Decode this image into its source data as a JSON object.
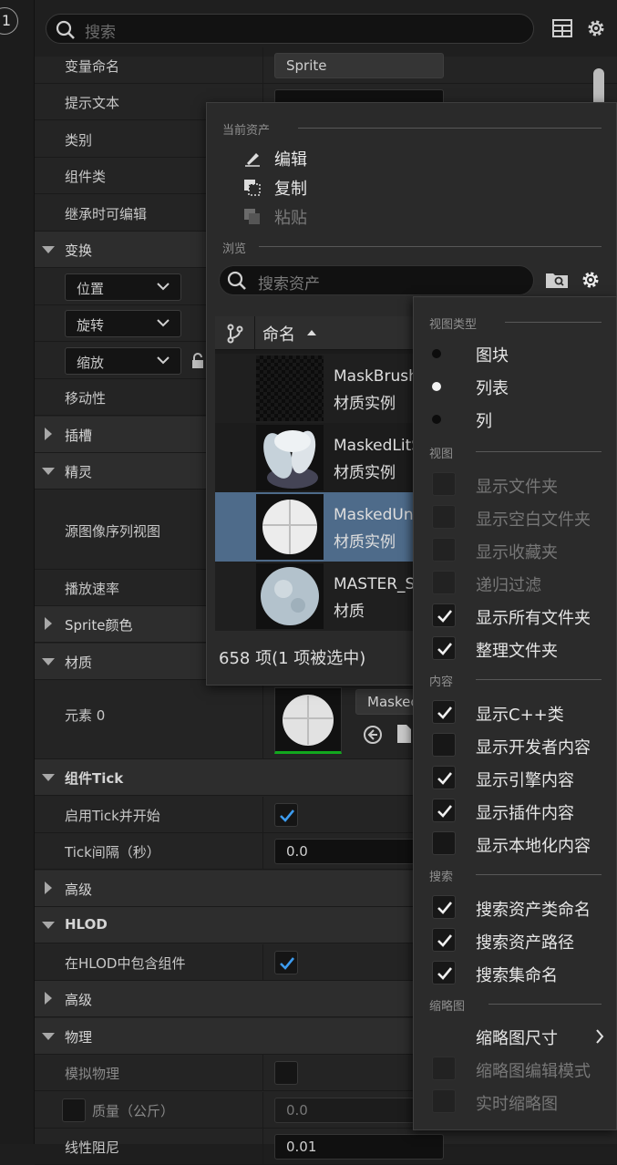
{
  "gutter_badge": "1",
  "details": {
    "search_placeholder": "搜索",
    "rows": {
      "var_name": "变量命名",
      "var_name_value": "Sprite",
      "tooltip": "提示文本",
      "category": "类别",
      "component_class": "组件类",
      "editable_inherit": "继承时可编辑",
      "transform": "变换",
      "location": "位置",
      "rotation": "旋转",
      "scale": "缩放",
      "mobility": "移动性",
      "sockets": "插槽",
      "sprite": "精灵",
      "source_flipbook": "源图像序列视图",
      "play_rate": "播放速率",
      "sprite_color": "Sprite颜色",
      "materials": "材质",
      "element0": "元素 0",
      "element0_value": "Maskec",
      "component_tick": "组件Tick",
      "start_with_tick": "启用Tick并开始",
      "tick_interval": "Tick间隔（秒）",
      "tick_interval_value": "0.0",
      "advanced1": "高级",
      "hlod": "HLOD",
      "include_in_hlod": "在HLOD中包含组件",
      "advanced2": "高级",
      "physics": "物理",
      "simulate_physics": "模拟物理",
      "mass": "质量（公斤）",
      "mass_value": "0.0",
      "linear_damping": "线性阻尼",
      "linear_damping_value": "0.01"
    }
  },
  "asset_picker": {
    "current_asset_header": "当前资产",
    "edit": "编辑",
    "copy": "复制",
    "paste": "粘贴",
    "browse_header": "浏览",
    "search_placeholder": "搜索资产",
    "column_name": "命名",
    "items": [
      {
        "name": "MaskBrush",
        "type": "材质实例"
      },
      {
        "name": "MaskedLitS",
        "type": "材质实例"
      },
      {
        "name": "MaskedUnl",
        "type": "材质实例"
      },
      {
        "name": "MASTER_S",
        "type": "材质"
      }
    ],
    "status": "658 项(1 项被选中)"
  },
  "settings_menu": {
    "view_type_header": "视图类型",
    "tiles": "图块",
    "list": "列表",
    "columns": "列",
    "view_header": "视图",
    "show_folders": "显示文件夹",
    "show_empty_folders": "显示空白文件夹",
    "show_favorites": "显示收藏夹",
    "recursive_filter": "递归过滤",
    "show_all_folders": "显示所有文件夹",
    "organize_folders": "整理文件夹",
    "content_header": "内容",
    "show_cpp": "显示C++类",
    "show_developer": "显示开发者内容",
    "show_engine": "显示引擎内容",
    "show_plugin": "显示插件内容",
    "show_localized": "显示本地化内容",
    "search_header": "搜索",
    "search_class_names": "搜索资产类命名",
    "search_asset_path": "搜索资产路径",
    "search_collection_names": "搜索集命名",
    "thumbnail_header": "缩略图",
    "thumbnail_size": "缩略图尺寸",
    "thumbnail_edit_mode": "缩略图编辑模式",
    "realtime_thumbnails": "实时缩略图"
  }
}
